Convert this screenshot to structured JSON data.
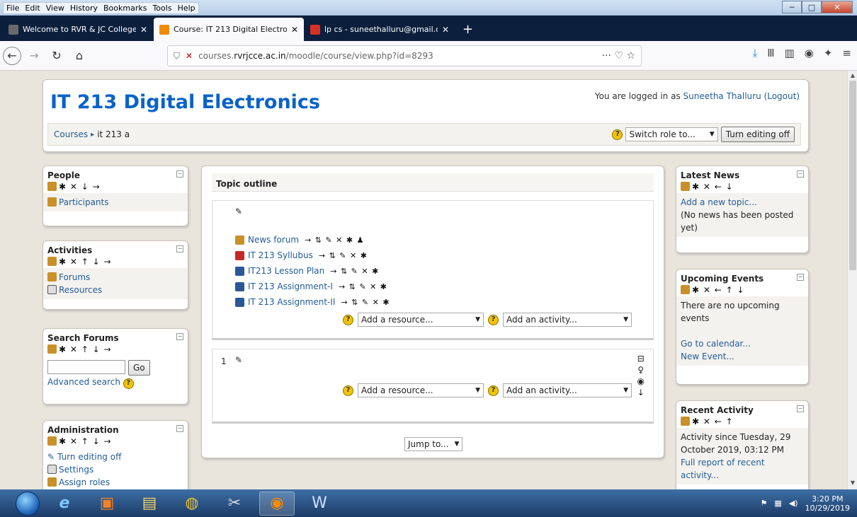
{
  "window": {
    "menu": [
      "File",
      "Edit",
      "View",
      "History",
      "Bookmarks",
      "Tools",
      "Help"
    ],
    "controls": [
      "─",
      "□",
      "✕"
    ]
  },
  "tabs": [
    {
      "title": "Welcome to RVR & JC College",
      "icon_color": "#6a6a6a",
      "active": false
    },
    {
      "title": "Course: IT 213 Digital Electronic",
      "icon_color": "#f08a00",
      "active": true
    },
    {
      "title": "lp cs - suneethalluru@gmail.co",
      "icon_color": "#d93025",
      "active": false
    }
  ],
  "tab_close": "✕",
  "new_tab": "+",
  "nav": {
    "url_prefix": "courses.",
    "url_host": "rvrjcce.ac.in",
    "url_path": "/moodle/course/view.php?id=8293",
    "page_actions": "··· ♡ ☆"
  },
  "header": {
    "course_title": "IT 213 Digital Electronics",
    "login_prefix": "You are logged in as ",
    "login_user": "Suneetha Thalluru",
    "login_logout": "(Logout)",
    "breadcrumb_root": "Courses",
    "breadcrumb_sep": "▸",
    "breadcrumb_current": "it 213 a",
    "switch_role": "Switch role to...",
    "turn_editing_off": "Turn editing off"
  },
  "left_blocks": {
    "people": {
      "title": "People",
      "ctrls": "✱ ✕ ↓ →",
      "items": [
        "Participants"
      ]
    },
    "activities": {
      "title": "Activities",
      "ctrls": "✱ ✕ ↑ ↓ →",
      "items": [
        "Forums",
        "Resources"
      ]
    },
    "search": {
      "title": "Search Forums",
      "ctrls": "✱ ✕ ↑ ↓ →",
      "go": "Go",
      "advanced": "Advanced search"
    },
    "admin": {
      "title": "Administration",
      "ctrls": "✱ ✕ ↑ ↓ →",
      "items": [
        "Turn editing off",
        "Settings",
        "Assign roles"
      ]
    }
  },
  "main": {
    "topic_outline": "Topic outline",
    "resources": [
      {
        "label": "News forum",
        "icons": "→ ⇅ ✎ ✕ ✱ ♟"
      },
      {
        "label": "IT 213 Syllubus",
        "icons": "→ ⇅ ✎ ✕ ✱"
      },
      {
        "label": "IT213 Lesson Plan",
        "icons": "→ ⇅ ✎ ✕ ✱"
      },
      {
        "label": "IT 213 Assignment-I",
        "icons": "→ ⇅ ✎ ✕ ✱"
      },
      {
        "label": "IT 213 Assignment-II",
        "icons": "→ ⇅ ✎ ✕ ✱"
      }
    ],
    "add_resource": "Add a resource...",
    "add_activity": "Add an activity...",
    "section_number": "1",
    "jump_to": "Jump to..."
  },
  "right_blocks": {
    "news": {
      "title": "Latest News",
      "ctrls": "✱ ✕ ← ↓",
      "add": "Add a new topic...",
      "empty": "(No news has been posted yet)"
    },
    "events": {
      "title": "Upcoming Events",
      "ctrls": "✱ ✕ ← ↑ ↓",
      "empty": "There are no upcoming events",
      "calendar": "Go to calendar...",
      "new_event": "New Event..."
    },
    "recent": {
      "title": "Recent Activity",
      "ctrls": "✱ ✕ ← ↑",
      "since": "Activity since Tuesday, 29 October 2019, 03:12 PM",
      "full_report": "Full report of recent activity..."
    }
  },
  "taskbar": {
    "time": "3:20 PM",
    "date": "10/29/2019"
  }
}
